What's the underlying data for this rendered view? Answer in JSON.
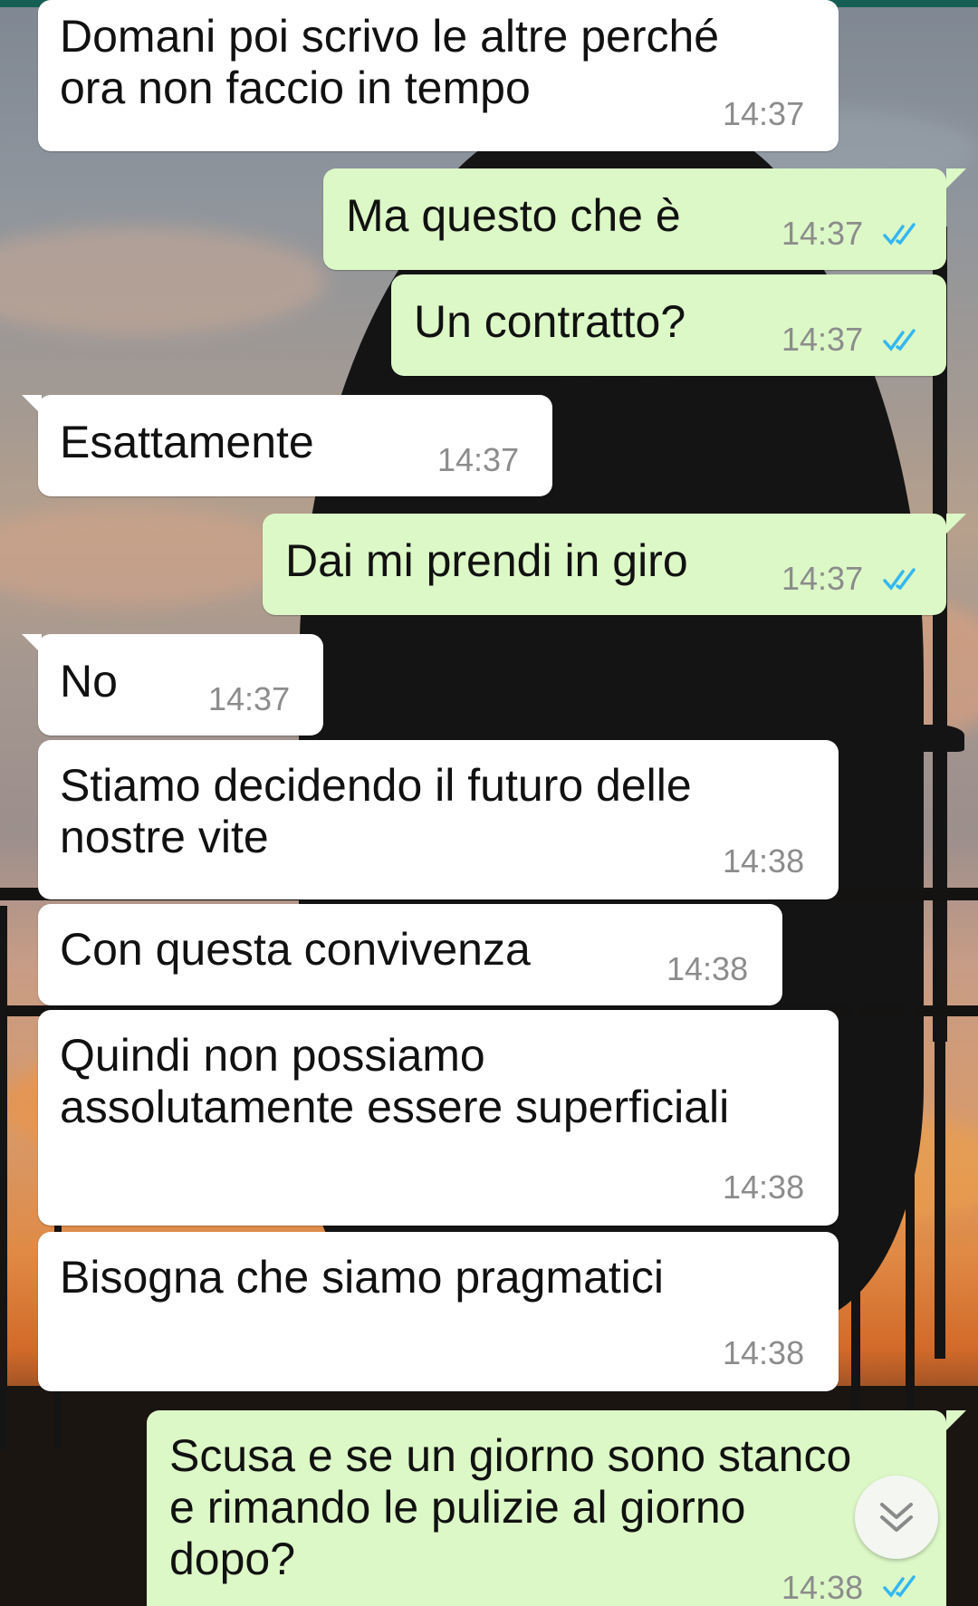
{
  "conversation": {
    "messages": [
      {
        "direction": "in",
        "text": "Domani poi scrivo le altre perché\nora non faccio in tempo",
        "time": "14:37",
        "read": false
      },
      {
        "direction": "out",
        "text": "Ma questo che è",
        "time": "14:37",
        "read": true
      },
      {
        "direction": "out",
        "text": "Un contratto?",
        "time": "14:37",
        "read": true
      },
      {
        "direction": "in",
        "text": "Esattamente",
        "time": "14:37",
        "read": false
      },
      {
        "direction": "out",
        "text": "Dai mi prendi in giro",
        "time": "14:37",
        "read": true
      },
      {
        "direction": "in",
        "text": "No",
        "time": "14:37",
        "read": false
      },
      {
        "direction": "in",
        "text": "Stiamo decidendo il futuro delle\nnostre vite",
        "time": "14:38",
        "read": false
      },
      {
        "direction": "in",
        "text": "Con questa convivenza",
        "time": "14:38",
        "read": false
      },
      {
        "direction": "in",
        "text": "Quindi non possiamo\nassolutamente essere superficiali",
        "time": "14:38",
        "read": false
      },
      {
        "direction": "in",
        "text": "Bisogna che siamo pragmatici",
        "time": "14:38",
        "read": false
      },
      {
        "direction": "out",
        "text": "Scusa e se un giorno sono stanco\ne rimando le pulizie al giorno\ndopo?",
        "time": "14:38",
        "read": true
      }
    ]
  },
  "colors": {
    "incoming_bubble": "#ffffff",
    "outgoing_bubble": "#dcf8c6",
    "read_ticks": "#34b7f1",
    "timestamp": "#8c8c8c"
  },
  "icons": {
    "read_receipt": "double-check-icon",
    "scroll_down": "chevron-double-down-icon"
  }
}
